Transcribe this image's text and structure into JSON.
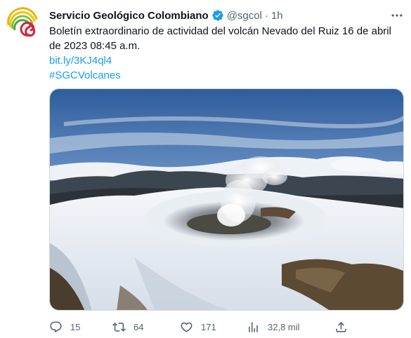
{
  "tweet": {
    "author_name": "Servicio Geológico Colombiano",
    "handle": "@sgcol",
    "separator": "·",
    "time": "1h",
    "text": "Boletín extraordinario de actividad del volcán Nevado del Ruiz 16 de abril de 2023 08:45 a.m.",
    "link": "bit.ly/3KJ4ql4",
    "hashtag": "#SGCVolcanes",
    "media_description": "Nevado del Ruiz crater with snow and steam plume",
    "stats": {
      "replies": "15",
      "retweets": "64",
      "likes": "171",
      "views": "32,8 mil"
    }
  },
  "colors": {
    "link": "#1d9bf0",
    "verified": "#1d9bf0",
    "secondary_text": "#536471"
  },
  "icons": {
    "verified": "verified-badge-icon",
    "more": "more-horizontal-icon",
    "reply": "reply-icon",
    "retweet": "retweet-icon",
    "like": "heart-icon",
    "views": "views-icon",
    "share": "share-icon"
  }
}
